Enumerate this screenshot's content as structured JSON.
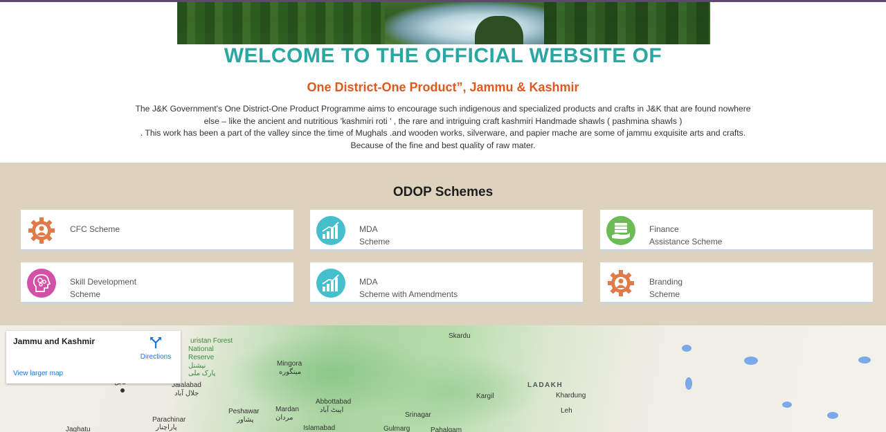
{
  "header": {
    "welcome": "WELCOME TO THE OFFICIAL WEBSITE OF",
    "subtitle": "One District-One Product”, Jammu & Kashmir",
    "intro_line1": "The J&K Government's One District-One Product Programme aims to encourage such indigenous and specialized products and crafts in J&K that are found nowhere",
    "intro_line2": "else – like the ancient and nutritious 'kashmiri roti ' , the rare and intriguing craft kashmiri Handmade shawls ( pashmina shawls )",
    "intro_line3": ". This work has been a part of the valley since the time of Mughals .and wooden works, silverware, and papier mache are some of jammu exquisite arts and crafts.",
    "intro_line4": "Because of the fine and best quality of raw mater."
  },
  "schemes": {
    "title": "ODOP Schemes",
    "items": [
      {
        "line1": "CFC Scheme",
        "line2": "",
        "icon": "gear-person-icon",
        "color": "#e07a48"
      },
      {
        "line1": "MDA",
        "line2": "Scheme",
        "icon": "bar-chart-icon",
        "color": "#45bfcc"
      },
      {
        "line1": "Finance",
        "line2": "Assistance Scheme",
        "icon": "money-hand-icon",
        "color": "#6dbb55"
      },
      {
        "line1": "Skill Development",
        "line2": "Scheme",
        "icon": "brain-head-icon",
        "color": "#d34fa8"
      },
      {
        "line1": "MDA",
        "line2": "Scheme with Amendments",
        "icon": "bar-chart-icon",
        "color": "#45bfcc"
      },
      {
        "line1": "Branding",
        "line2": "Scheme",
        "icon": "gear-person-icon",
        "color": "#e07a48"
      }
    ]
  },
  "map": {
    "place": "Jammu and Kashmir",
    "directions": "Directions",
    "larger_map": "View larger map",
    "labels": {
      "skardu": "Skardu",
      "forest": "uristan Forest",
      "national": "National",
      "reserve": "Reserve",
      "reserve_ur": "نیشنل",
      "reserve_ur2": "پارک ملی",
      "mingora": "Mingora",
      "mingora_ur": "مینگوره",
      "ladakh": "LADAKH",
      "khardung": "Khardung",
      "jalalabad": "Jalalabad",
      "jalalabad_ur": "جلال آباد",
      "kargil": "Kargil",
      "abbottabad": "Abbottabad",
      "abbottabad_ur": "ایبٹ آباد",
      "peshawar": "Peshawar",
      "peshawar_ur": "پشاور",
      "mardan": "Mardan",
      "mardan_ur": "مردان",
      "srinagar": "Srinagar",
      "leh": "Leh",
      "parachinar": "Parachinar",
      "parachinar_ur": "پاراچنار",
      "islamabad": "Islamabad",
      "gulmarg": "Gulmarg",
      "pahalgam": "Pahalgam",
      "jaghatu": "Jaghatu",
      "kabul_ur": "کابل"
    }
  }
}
